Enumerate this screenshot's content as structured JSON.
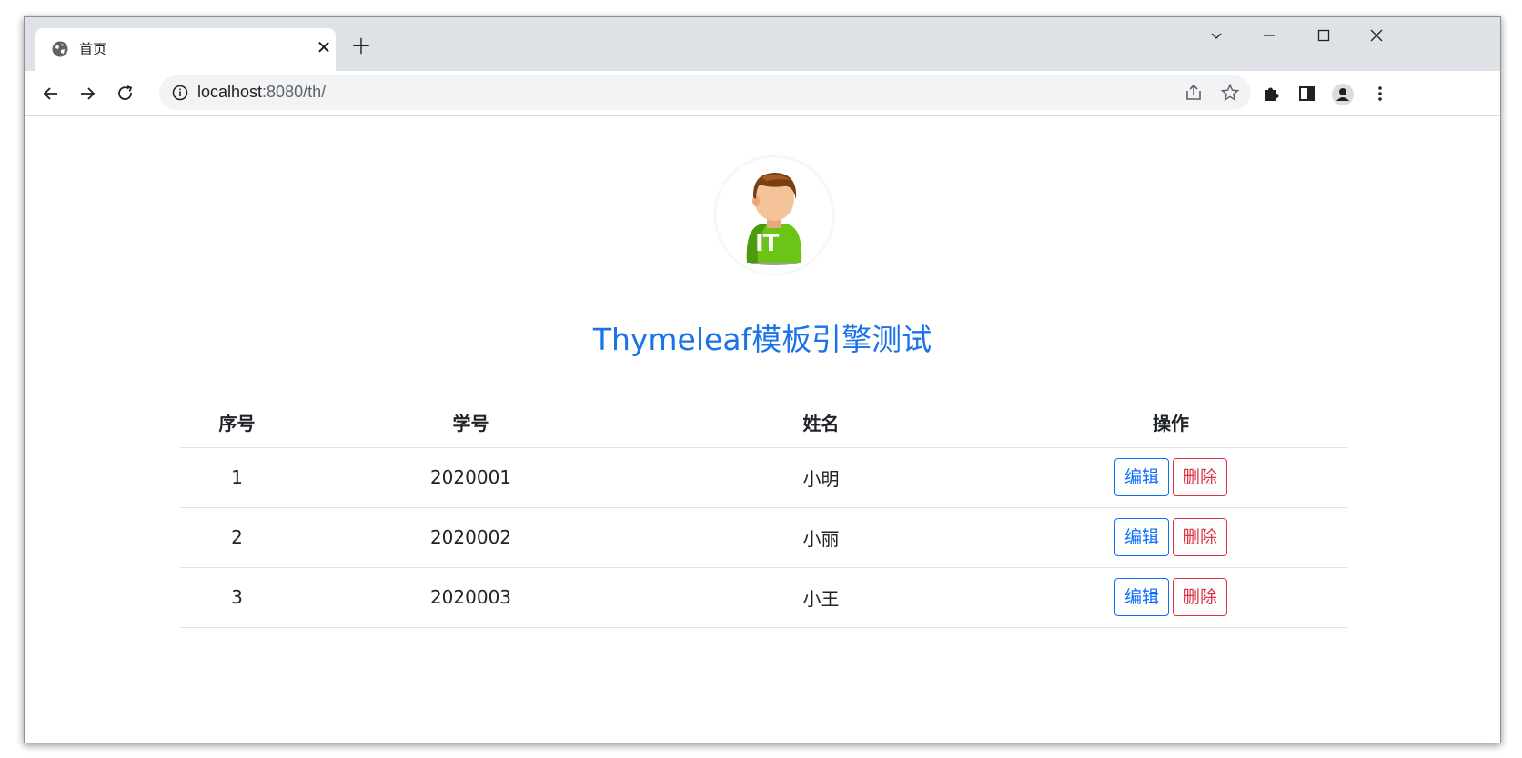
{
  "browser": {
    "tab": {
      "title": "首页",
      "close": "✕"
    },
    "new_tab": "+",
    "url_host": "localhost",
    "url_path": ":8080/th/"
  },
  "page": {
    "title": "Thymeleaf模板引擎测试",
    "avatar_text": "IT"
  },
  "table": {
    "headers": [
      "序号",
      "学号",
      "姓名",
      "操作"
    ],
    "rows": [
      {
        "index": "1",
        "student_id": "2020001",
        "name": "小明",
        "edit": "编辑",
        "delete": "删除"
      },
      {
        "index": "2",
        "student_id": "2020002",
        "name": "小丽",
        "edit": "编辑",
        "delete": "删除"
      },
      {
        "index": "3",
        "student_id": "2020003",
        "name": "小王",
        "edit": "编辑",
        "delete": "删除"
      }
    ]
  },
  "colors": {
    "title": "#1a73e8",
    "edit": "#0d6efd",
    "delete": "#dc3545"
  }
}
